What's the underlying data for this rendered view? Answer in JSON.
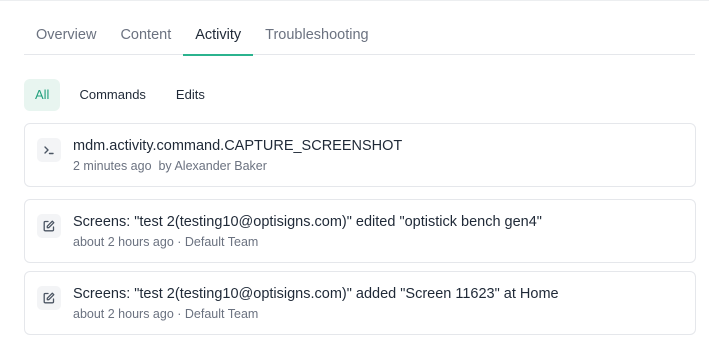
{
  "tabs": [
    {
      "label": "Overview"
    },
    {
      "label": "Content"
    },
    {
      "label": "Activity"
    },
    {
      "label": "Troubleshooting"
    }
  ],
  "active_tab": "Activity",
  "filters": [
    {
      "label": "All"
    },
    {
      "label": "Commands"
    },
    {
      "label": "Edits"
    }
  ],
  "active_filter": "All",
  "activities": [
    {
      "icon": "terminal-icon",
      "title": "mdm.activity.command.CAPTURE_SCREENSHOT",
      "time": "2 minutes ago",
      "separator": "",
      "actor": "by Alexander Baker"
    },
    {
      "icon": "edit-icon",
      "title": "Screens: \"test 2(testing10@optisigns.com)\" edited \"optistick bench gen4\"",
      "time": "about 2 hours ago",
      "separator": " · ",
      "actor": "Default Team"
    },
    {
      "icon": "edit-icon",
      "title": "Screens: \"test 2(testing10@optisigns.com)\" added \"Screen 11623\" at Home",
      "time": "about 2 hours ago",
      "separator": " · ",
      "actor": "Default Team"
    }
  ],
  "colors": {
    "accent": "#2bb38e",
    "accent_bg": "#e8f5f0",
    "text": "#1f2937",
    "muted": "#6b7280",
    "border": "#e5e7eb"
  }
}
